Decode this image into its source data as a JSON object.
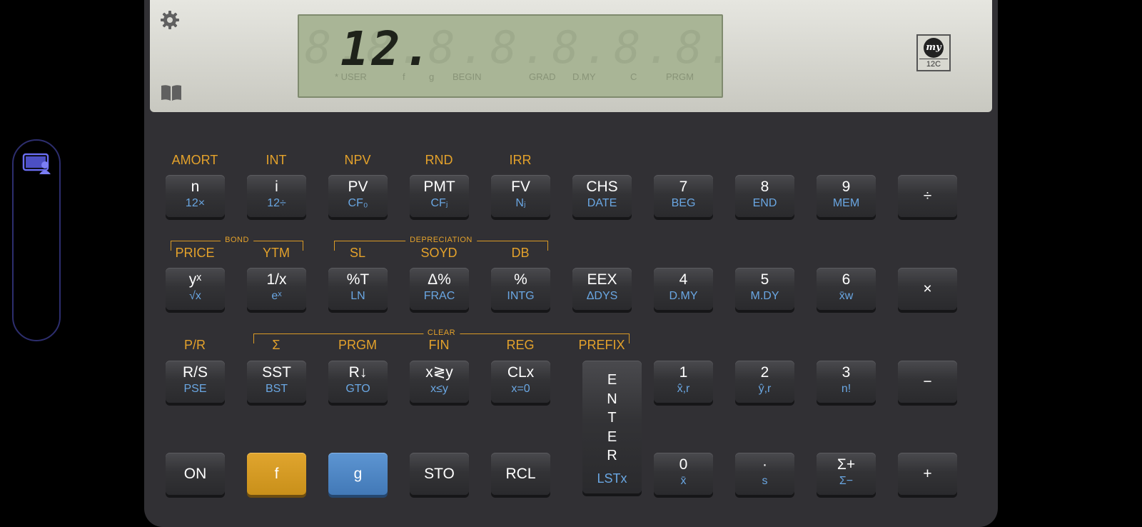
{
  "display": {
    "value": "12.",
    "ghost": "8.8.8.8.8.8.8.8.8.8.",
    "annunciators": [
      "* USER",
      "f",
      "g",
      "BEGIN",
      "GRAD",
      "D.MY",
      "C",
      "PRGM"
    ]
  },
  "logo": {
    "brand": "my",
    "model": "12C"
  },
  "brackets": {
    "bond": "BOND",
    "depreciation": "DEPRECIATION",
    "clear": "CLEAR"
  },
  "row1": {
    "gold": [
      "AMORT",
      "INT",
      "NPV",
      "RND",
      "IRR"
    ],
    "keys": [
      {
        "main": "n",
        "blue": "12×"
      },
      {
        "main": "i",
        "blue": "12÷"
      },
      {
        "main": "PV",
        "blue": "CF₀"
      },
      {
        "main": "PMT",
        "blue": "CFⱼ"
      },
      {
        "main": "FV",
        "blue": "Nⱼ"
      },
      {
        "main": "CHS",
        "blue": "DATE"
      },
      {
        "main": "7",
        "blue": "BEG"
      },
      {
        "main": "8",
        "blue": "END"
      },
      {
        "main": "9",
        "blue": "MEM"
      },
      {
        "main": "÷",
        "blue": ""
      }
    ]
  },
  "row2": {
    "gold": [
      "PRICE",
      "YTM",
      "SL",
      "SOYD",
      "DB"
    ],
    "keys": [
      {
        "main": "yˣ",
        "blue": "√x"
      },
      {
        "main": "1/x",
        "blue": "eˣ"
      },
      {
        "main": "%T",
        "blue": "LN"
      },
      {
        "main": "Δ%",
        "blue": "FRAC"
      },
      {
        "main": "%",
        "blue": "INTG"
      },
      {
        "main": "EEX",
        "blue": "ΔDYS"
      },
      {
        "main": "4",
        "blue": "D.MY"
      },
      {
        "main": "5",
        "blue": "M.DY"
      },
      {
        "main": "6",
        "blue": "x̄w"
      },
      {
        "main": "×",
        "blue": ""
      }
    ]
  },
  "row3": {
    "gold": [
      "P/R",
      "Σ",
      "PRGM",
      "FIN",
      "REG",
      "PREFIX"
    ],
    "keys": [
      {
        "main": "R/S",
        "blue": "PSE"
      },
      {
        "main": "SST",
        "blue": "BST"
      },
      {
        "main": "R↓",
        "blue": "GTO"
      },
      {
        "main": "x≷y",
        "blue": "x≤y"
      },
      {
        "main": "CLx",
        "blue": "x=0"
      },
      {
        "main": "1",
        "blue": "x̂,r"
      },
      {
        "main": "2",
        "blue": "ŷ,r"
      },
      {
        "main": "3",
        "blue": "n!"
      },
      {
        "main": "−",
        "blue": ""
      }
    ]
  },
  "enter": {
    "letters": [
      "E",
      "N",
      "T",
      "E",
      "R"
    ],
    "blue": "LSTx"
  },
  "row4": {
    "keys": [
      {
        "main": "ON",
        "blue": ""
      },
      {
        "main": "f",
        "blue": ""
      },
      {
        "main": "g",
        "blue": ""
      },
      {
        "main": "STO",
        "blue": ""
      },
      {
        "main": "RCL",
        "blue": ""
      },
      {
        "main": "0",
        "blue": "x̄"
      },
      {
        "main": "·",
        "blue": "s"
      },
      {
        "main": "Σ+",
        "blue": "Σ−"
      },
      {
        "main": "+",
        "blue": ""
      }
    ]
  },
  "colors": {
    "gold": "#e4a22b",
    "blue": "#6aa7e3",
    "f_key": "#d89e24",
    "g_key": "#4f87c4",
    "lcd": "#a9b596"
  }
}
